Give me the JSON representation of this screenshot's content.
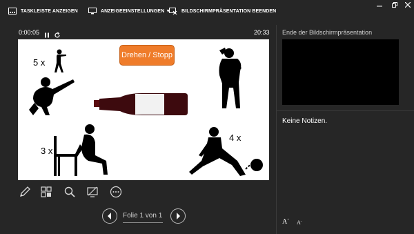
{
  "toolbar": {
    "taskbar_label": "TASKLEISTE ANZEIGEN",
    "display_settings_label": "ANZEIGEEINSTELLUNGEN",
    "display_settings_caret": "▼",
    "end_show_label": "BILDSCHIRMPRÄSENTATION BEENDEN"
  },
  "timer": {
    "elapsed": "0:00:05",
    "clock": "20:33"
  },
  "slide": {
    "spin_button": "Drehen / Stopp",
    "label_top_left": "5 x",
    "label_bottom_left": "3 x",
    "label_bottom_right": "4 x"
  },
  "navigation": {
    "counter": "Folie 1 von 1"
  },
  "side_panel": {
    "next_slide_label": "Ende der Bildschirmpräsentation",
    "notes_text": "Keine Notizen.",
    "font_increase": "A",
    "font_decrease": "A"
  },
  "colors": {
    "background": "#262626",
    "accent_button": "#ef7c2a"
  },
  "icons": [
    "taskbar-icon",
    "display-settings-icon",
    "end-show-icon",
    "minimize-icon",
    "restore-icon",
    "close-icon",
    "pause-icon",
    "reset-icon",
    "pen-icon",
    "slides-grid-icon",
    "zoom-icon",
    "screen-icon",
    "more-icon",
    "previous-icon",
    "next-icon"
  ]
}
